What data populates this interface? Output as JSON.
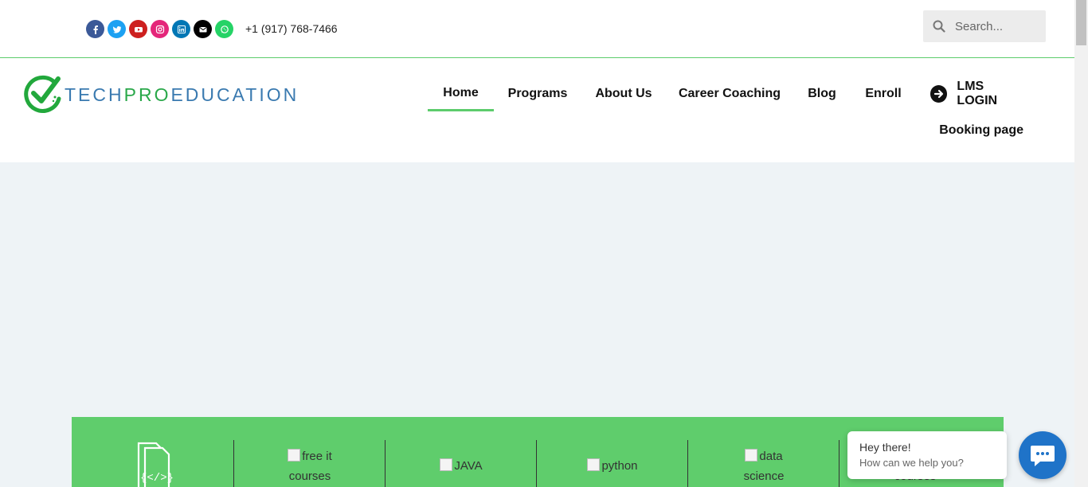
{
  "topbar": {
    "social_icons": [
      {
        "name": "facebook-icon",
        "color": "#3b5998"
      },
      {
        "name": "twitter-icon",
        "color": "#1da1f2"
      },
      {
        "name": "youtube-icon",
        "color": "#cd201f"
      },
      {
        "name": "instagram-icon",
        "color": "#e4267a"
      },
      {
        "name": "linkedin-icon",
        "color": "#0077b5"
      },
      {
        "name": "envelope-icon",
        "color": "#000000"
      },
      {
        "name": "whatsapp-icon",
        "color": "#25d366"
      }
    ],
    "phone": "+1 (917) 768-7466",
    "search_placeholder": "Search..."
  },
  "header": {
    "logo": {
      "prefix": "TECH",
      "highlight": "PRO",
      "suffix": "EDUCATION"
    },
    "nav": [
      {
        "label": "Home",
        "active": true
      },
      {
        "label": "Programs"
      },
      {
        "label": "About Us"
      },
      {
        "label": "Career Coaching"
      },
      {
        "label": "Blog"
      },
      {
        "label": "Enroll"
      },
      {
        "label": "LMS LOGIN"
      },
      {
        "label": "Booking page"
      }
    ]
  },
  "features": {
    "items": [
      {
        "alt_line1": "free it",
        "alt_line2": "courses"
      },
      {
        "alt_line1": "JAVA"
      },
      {
        "alt_line1": "python"
      },
      {
        "alt_line1": "data",
        "alt_line2": "science"
      },
      {
        "alt_line1": "courses"
      }
    ]
  },
  "chat": {
    "title": "Hey there!",
    "subtitle": "How can we help you?"
  },
  "colors": {
    "accent_green": "#5fcd6c",
    "chat_blue": "#1f73c8"
  }
}
